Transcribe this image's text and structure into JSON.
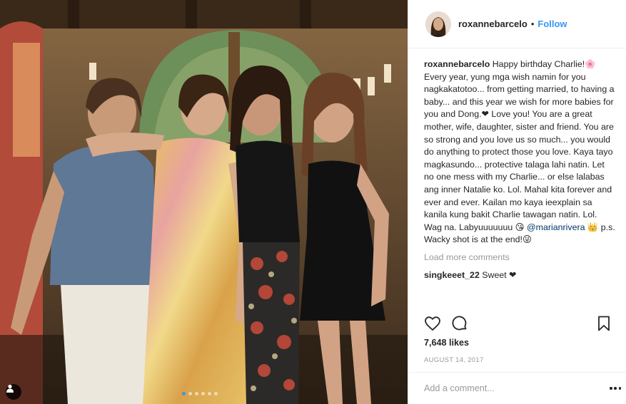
{
  "post": {
    "username": "roxannebarcelo",
    "separator": "•",
    "follow_label": "Follow",
    "caption_user": "roxannebarcelo",
    "caption_part1": " Happy birthday Charlie!🌸 Every year, yung mga wish namin for you nagkakatotoo... from getting married, to having a baby... and this year we wish for more babies for you and Dong.❤ Love you! You are a great mother, wife, daughter, sister and friend. You are so strong and you love us so much... you would do anything to protect those you love. Kaya tayo magkasundo... protective talaga lahi natin. Let no one mess with my Charlie... or else lalabas ang inner Natalie ko. Lol. Mahal kita forever and ever and ever. Kailan mo kaya ieexplain sa kanila kung bakit Charlie tawagan natin. Lol. Wag na. Labyuuuuuuu 😘 ",
    "caption_mention": "@marianrivera",
    "caption_part2": " 👑 p.s. Wacky shot is at the end!😜",
    "load_more_label": "Load more comments",
    "comments": [
      {
        "user": "singkeeet_22",
        "text": " Sweet ❤"
      }
    ],
    "likes_text": "7,648 likes",
    "date": "AUGUST 14, 2017",
    "comment_placeholder": "Add a comment..."
  },
  "icons": {
    "like": "heart-icon",
    "comment": "comment-icon",
    "save": "bookmark-icon",
    "more": "more-options-icon",
    "tagged": "user-tag-icon"
  },
  "carousel": {
    "total": 6,
    "active": 1
  },
  "colors": {
    "link_blue": "#3897f0",
    "text": "#262626",
    "muted": "#999999",
    "border": "#efefef"
  }
}
